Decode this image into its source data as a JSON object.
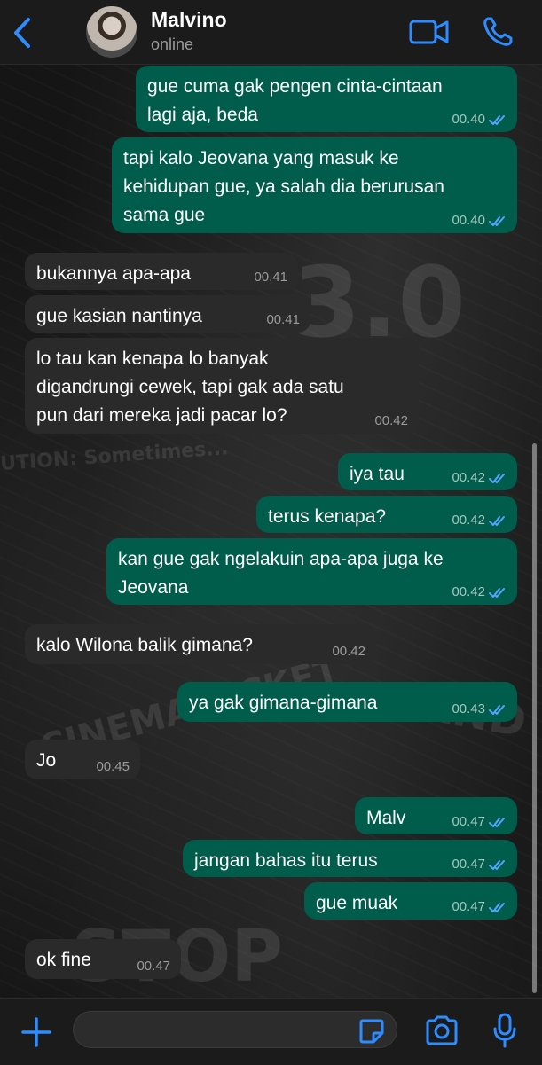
{
  "header": {
    "contact_name": "Malvino",
    "status": "online"
  },
  "messages": [
    {
      "side": "out",
      "text": "gue cuma gak pengen cinta-cintaan\nlagi aja, beda",
      "time": "00.40",
      "read": true
    },
    {
      "side": "out",
      "text": "tapi kalo Jeovana yang masuk ke\nkehidupan gue, ya salah dia berurusan\nsama gue",
      "time": "00.40",
      "read": true
    },
    {
      "side": "in",
      "text": "bukannya apa-apa",
      "time": "00.41"
    },
    {
      "side": "in",
      "text": "gue kasian nantinya",
      "time": "00.41"
    },
    {
      "side": "in",
      "text": "lo tau kan kenapa lo banyak\ndigandrungi cewek, tapi gak ada satu\npun dari mereka jadi pacar lo?",
      "time": "00.42"
    },
    {
      "side": "out",
      "text": "iya tau",
      "time": "00.42",
      "read": true
    },
    {
      "side": "out",
      "text": "terus kenapa?",
      "time": "00.42",
      "read": true
    },
    {
      "side": "out",
      "text": "kan gue gak ngelakuin apa-apa juga ke\nJeovana",
      "time": "00.42",
      "read": true
    },
    {
      "side": "in",
      "text": "kalo Wilona balik gimana?",
      "time": "00.42"
    },
    {
      "side": "out",
      "text": "ya gak gimana-gimana",
      "time": "00.43",
      "read": true
    },
    {
      "side": "in",
      "text": "Jo",
      "time": "00.45"
    },
    {
      "side": "out",
      "text": "Malv",
      "time": "00.47",
      "read": true
    },
    {
      "side": "out",
      "text": "jangan bahas itu terus",
      "time": "00.47",
      "read": true
    },
    {
      "side": "out",
      "text": "gue muak",
      "time": "00.47",
      "read": true
    },
    {
      "side": "in",
      "text": "ok fine",
      "time": "00.47"
    }
  ],
  "composer": {
    "value": ""
  },
  "colors": {
    "accent": "#2f8cff",
    "outgoing_bubble": "#005c4b",
    "incoming_bubble": "#2a2a2a",
    "read_tick": "#53a6fd"
  },
  "icons": {
    "back": "chevron-left-icon",
    "video": "video-camera-icon",
    "call": "phone-icon",
    "plus": "plus-icon",
    "sticker": "sticker-icon",
    "camera": "camera-icon",
    "mic": "microphone-icon"
  }
}
